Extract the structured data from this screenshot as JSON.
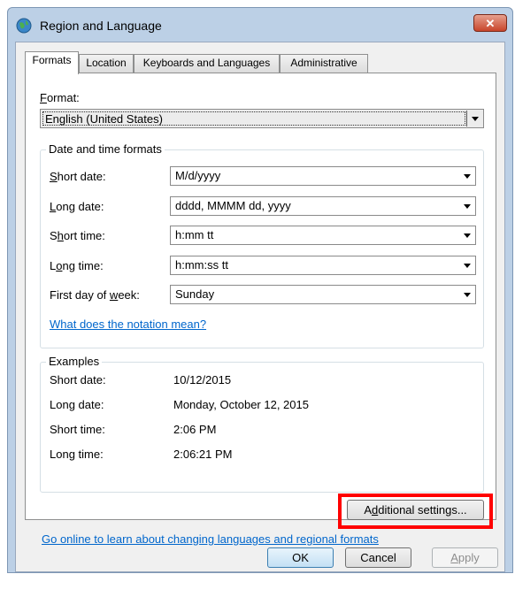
{
  "window": {
    "title": "Region and Language",
    "close_label": "✕"
  },
  "tabs": [
    {
      "label": "Formats",
      "active": true
    },
    {
      "label": "Location",
      "active": false
    },
    {
      "label": "Keyboards and Languages",
      "active": false
    },
    {
      "label": "Administrative",
      "active": false
    }
  ],
  "format": {
    "label_pre": "",
    "label_u": "F",
    "label_post": "ormat:",
    "value": "English (United States)"
  },
  "date_time": {
    "group_title": "Date and time formats",
    "short_date": {
      "label_u": "S",
      "label_post": "hort date:",
      "value": "M/d/yyyy"
    },
    "long_date": {
      "label_u": "L",
      "label_post": "ong date:",
      "value": "dddd, MMMM dd, yyyy"
    },
    "short_time": {
      "label_pre": "S",
      "label_u": "h",
      "label_post": "ort time:",
      "value": "h:mm tt"
    },
    "long_time": {
      "label_pre": "L",
      "label_u": "o",
      "label_post": "ng time:",
      "value": "h:mm:ss tt"
    },
    "first_day": {
      "label_pre": "First day of ",
      "label_u": "w",
      "label_post": "eek:",
      "value": "Sunday"
    },
    "notation_link": "What does the notation mean?"
  },
  "examples": {
    "group_title": "Examples",
    "short_date": {
      "label": "Short date:",
      "value": "10/12/2015"
    },
    "long_date": {
      "label": "Long date:",
      "value": "Monday, October 12, 2015"
    },
    "short_time": {
      "label": "Short time:",
      "value": "2:06 PM"
    },
    "long_time": {
      "label": "Long time:",
      "value": "2:06:21 PM"
    }
  },
  "additional_settings": {
    "label_pre": "A",
    "label_u": "d",
    "label_post": "ditional settings..."
  },
  "online_link": "Go online to learn about changing languages and regional formats",
  "buttons": {
    "ok": "OK",
    "cancel": "Cancel",
    "apply_u": "A",
    "apply_post": "pply"
  },
  "colors": {
    "highlight": "#ff0000",
    "link": "#0066cc"
  }
}
